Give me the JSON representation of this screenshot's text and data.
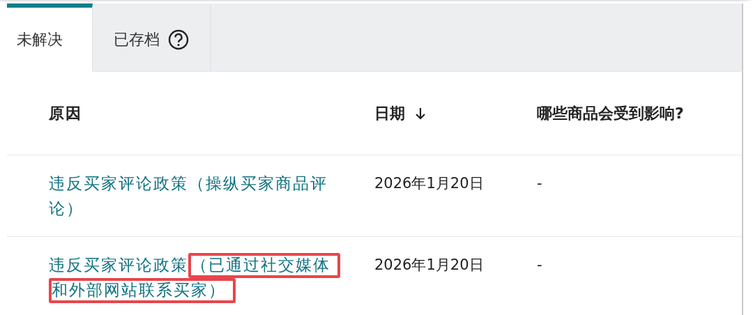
{
  "tabs": [
    {
      "label": "未解决",
      "selected": true,
      "help": false
    },
    {
      "label": "已存档",
      "selected": false,
      "help": true
    }
  ],
  "table": {
    "columns": [
      {
        "label": "原因",
        "sorted": false
      },
      {
        "label": "日期",
        "sorted": true
      },
      {
        "label": "哪些商品会受到影响?",
        "sorted": false
      }
    ],
    "rows": [
      {
        "reason": [
          {
            "text": "违反买家评论政策（操纵买家商品评论）",
            "highlighted": false
          }
        ],
        "date": "2026年1月20日",
        "affected": "-"
      },
      {
        "reason": [
          {
            "text": "违反买家评论政策",
            "highlighted": false
          },
          {
            "text": "（已通过社交媒体和外部网站联系买家）",
            "highlighted": true
          }
        ],
        "date": "2026年1月20日",
        "affected": "-"
      }
    ]
  }
}
